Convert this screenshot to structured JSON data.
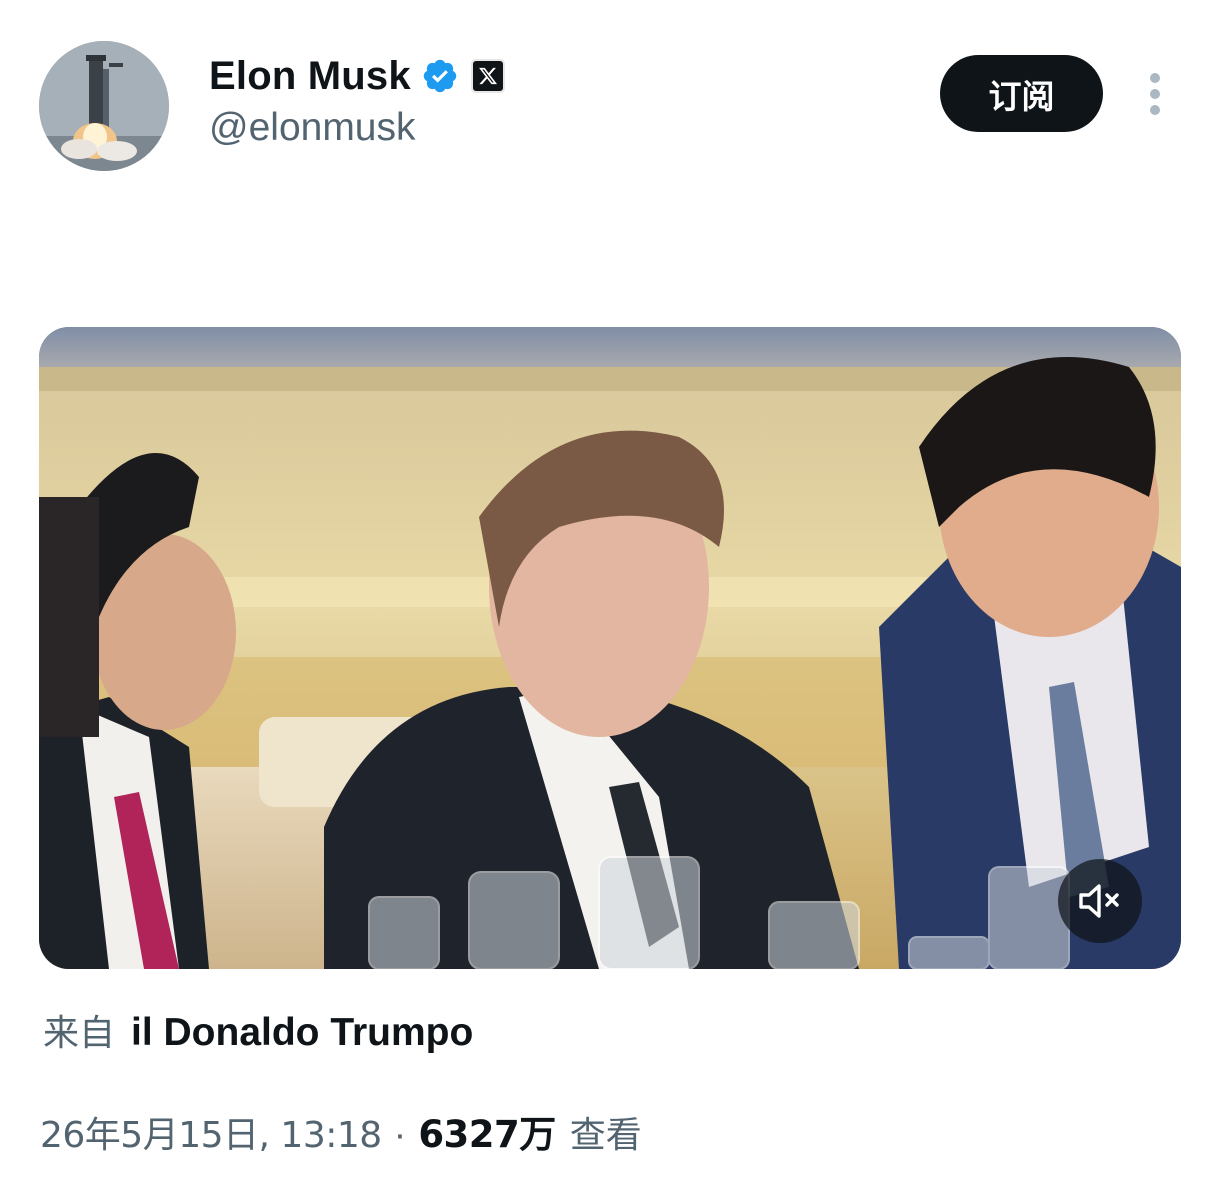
{
  "author": {
    "display_name": "Elon Musk",
    "handle": "@elonmusk",
    "avatar_icon": "rocket-launch-avatar",
    "verified_icon": "verified-badge-icon",
    "affiliate_badge_icon": "x-logo-icon"
  },
  "actions": {
    "subscribe_label": "订阅",
    "more_icon": "more-vertical-icon"
  },
  "media": {
    "type": "video",
    "mute_icon": "volume-muted-icon"
  },
  "attribution": {
    "prefix": "来自",
    "source": "il Donaldo Trumpo"
  },
  "meta": {
    "timestamp": "26年5月15日, 13:18",
    "separator": "·",
    "views_count": "6327万",
    "views_label": "查看"
  },
  "colors": {
    "text_primary": "#0f1419",
    "text_secondary": "#536471",
    "verified_blue": "#1d9bf0",
    "button_bg": "#0f1419"
  }
}
